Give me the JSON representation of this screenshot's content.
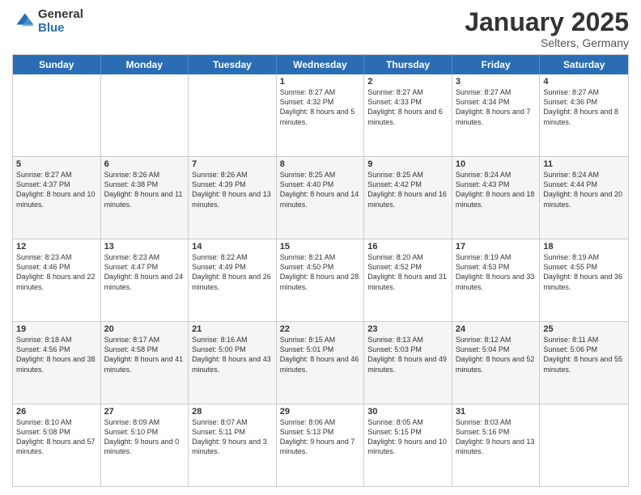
{
  "logo": {
    "general": "General",
    "blue": "Blue"
  },
  "title": "January 2025",
  "location": "Selters, Germany",
  "days": [
    "Sunday",
    "Monday",
    "Tuesday",
    "Wednesday",
    "Thursday",
    "Friday",
    "Saturday"
  ],
  "weeks": [
    [
      {
        "day": "",
        "info": ""
      },
      {
        "day": "",
        "info": ""
      },
      {
        "day": "",
        "info": ""
      },
      {
        "day": "1",
        "info": "Sunrise: 8:27 AM\nSunset: 4:32 PM\nDaylight: 8 hours\nand 5 minutes."
      },
      {
        "day": "2",
        "info": "Sunrise: 8:27 AM\nSunset: 4:33 PM\nDaylight: 8 hours\nand 6 minutes."
      },
      {
        "day": "3",
        "info": "Sunrise: 8:27 AM\nSunset: 4:34 PM\nDaylight: 8 hours\nand 7 minutes."
      },
      {
        "day": "4",
        "info": "Sunrise: 8:27 AM\nSunset: 4:36 PM\nDaylight: 8 hours\nand 8 minutes."
      }
    ],
    [
      {
        "day": "5",
        "info": "Sunrise: 8:27 AM\nSunset: 4:37 PM\nDaylight: 8 hours\nand 10 minutes."
      },
      {
        "day": "6",
        "info": "Sunrise: 8:26 AM\nSunset: 4:38 PM\nDaylight: 8 hours\nand 11 minutes."
      },
      {
        "day": "7",
        "info": "Sunrise: 8:26 AM\nSunset: 4:39 PM\nDaylight: 8 hours\nand 13 minutes."
      },
      {
        "day": "8",
        "info": "Sunrise: 8:25 AM\nSunset: 4:40 PM\nDaylight: 8 hours\nand 14 minutes."
      },
      {
        "day": "9",
        "info": "Sunrise: 8:25 AM\nSunset: 4:42 PM\nDaylight: 8 hours\nand 16 minutes."
      },
      {
        "day": "10",
        "info": "Sunrise: 8:24 AM\nSunset: 4:43 PM\nDaylight: 8 hours\nand 18 minutes."
      },
      {
        "day": "11",
        "info": "Sunrise: 8:24 AM\nSunset: 4:44 PM\nDaylight: 8 hours\nand 20 minutes."
      }
    ],
    [
      {
        "day": "12",
        "info": "Sunrise: 8:23 AM\nSunset: 4:46 PM\nDaylight: 8 hours\nand 22 minutes."
      },
      {
        "day": "13",
        "info": "Sunrise: 8:23 AM\nSunset: 4:47 PM\nDaylight: 8 hours\nand 24 minutes."
      },
      {
        "day": "14",
        "info": "Sunrise: 8:22 AM\nSunset: 4:49 PM\nDaylight: 8 hours\nand 26 minutes."
      },
      {
        "day": "15",
        "info": "Sunrise: 8:21 AM\nSunset: 4:50 PM\nDaylight: 8 hours\nand 28 minutes."
      },
      {
        "day": "16",
        "info": "Sunrise: 8:20 AM\nSunset: 4:52 PM\nDaylight: 8 hours\nand 31 minutes."
      },
      {
        "day": "17",
        "info": "Sunrise: 8:19 AM\nSunset: 4:53 PM\nDaylight: 8 hours\nand 33 minutes."
      },
      {
        "day": "18",
        "info": "Sunrise: 8:19 AM\nSunset: 4:55 PM\nDaylight: 8 hours\nand 36 minutes."
      }
    ],
    [
      {
        "day": "19",
        "info": "Sunrise: 8:18 AM\nSunset: 4:56 PM\nDaylight: 8 hours\nand 38 minutes."
      },
      {
        "day": "20",
        "info": "Sunrise: 8:17 AM\nSunset: 4:58 PM\nDaylight: 8 hours\nand 41 minutes."
      },
      {
        "day": "21",
        "info": "Sunrise: 8:16 AM\nSunset: 5:00 PM\nDaylight: 8 hours\nand 43 minutes."
      },
      {
        "day": "22",
        "info": "Sunrise: 8:15 AM\nSunset: 5:01 PM\nDaylight: 8 hours\nand 46 minutes."
      },
      {
        "day": "23",
        "info": "Sunrise: 8:13 AM\nSunset: 5:03 PM\nDaylight: 8 hours\nand 49 minutes."
      },
      {
        "day": "24",
        "info": "Sunrise: 8:12 AM\nSunset: 5:04 PM\nDaylight: 8 hours\nand 52 minutes."
      },
      {
        "day": "25",
        "info": "Sunrise: 8:11 AM\nSunset: 5:06 PM\nDaylight: 8 hours\nand 55 minutes."
      }
    ],
    [
      {
        "day": "26",
        "info": "Sunrise: 8:10 AM\nSunset: 5:08 PM\nDaylight: 8 hours\nand 57 minutes."
      },
      {
        "day": "27",
        "info": "Sunrise: 8:09 AM\nSunset: 5:10 PM\nDaylight: 9 hours\nand 0 minutes."
      },
      {
        "day": "28",
        "info": "Sunrise: 8:07 AM\nSunset: 5:11 PM\nDaylight: 9 hours\nand 3 minutes."
      },
      {
        "day": "29",
        "info": "Sunrise: 8:06 AM\nSunset: 5:13 PM\nDaylight: 9 hours\nand 7 minutes."
      },
      {
        "day": "30",
        "info": "Sunrise: 8:05 AM\nSunset: 5:15 PM\nDaylight: 9 hours\nand 10 minutes."
      },
      {
        "day": "31",
        "info": "Sunrise: 8:03 AM\nSunset: 5:16 PM\nDaylight: 9 hours\nand 13 minutes."
      },
      {
        "day": "",
        "info": ""
      }
    ]
  ]
}
